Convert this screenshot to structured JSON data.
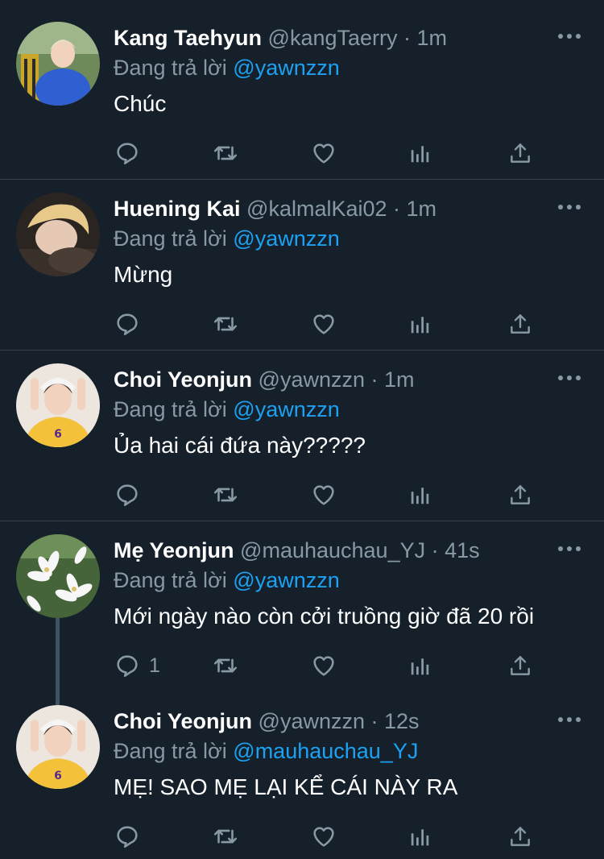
{
  "tweets": [
    {
      "name": "Kang Taehyun",
      "handle": "@kangTaerry",
      "time": "· 1m",
      "replying_prefix": "Đang trả lời",
      "replying_to": "@yawnzzn",
      "text": "Chúc",
      "reply_count": ""
    },
    {
      "name": "Huening Kai",
      "handle": "@kalmalKai02",
      "time": "· 1m",
      "replying_prefix": "Đang trả lời",
      "replying_to": "@yawnzzn",
      "text": "Mừng",
      "reply_count": ""
    },
    {
      "name": "Choi Yeonjun",
      "handle": "@yawnzzn",
      "time": "· 1m",
      "replying_prefix": "Đang trả lời",
      "replying_to": "@yawnzzn",
      "text": "Ủa hai cái đứa này?????",
      "reply_count": ""
    },
    {
      "name": "Mẹ Yeonjun",
      "handle": "@mauhauchau_YJ",
      "time": "· 41s",
      "replying_prefix": "Đang trả lời",
      "replying_to": "@yawnzzn",
      "text": "Mới ngày nào còn cởi truồng giờ đã 20 rồi",
      "reply_count": "1"
    },
    {
      "name": "Choi Yeonjun",
      "handle": "@yawnzzn",
      "time": "· 12s",
      "replying_prefix": "Đang trả lời",
      "replying_to": "@mauhauchau_YJ",
      "text": "MẸ! SAO MẸ LẠI KỂ CÁI NÀY RA",
      "reply_count": ""
    }
  ],
  "icons": {
    "reply": "reply-icon",
    "retweet": "retweet-icon",
    "like": "heart-icon",
    "analytics": "analytics-icon",
    "share": "share-icon",
    "more": "more-icon"
  },
  "colors": {
    "background": "#15202b",
    "divider": "#38444d",
    "secondary_text": "#8899a6",
    "mention": "#1da1f2",
    "thread_line": "#3d5466"
  }
}
